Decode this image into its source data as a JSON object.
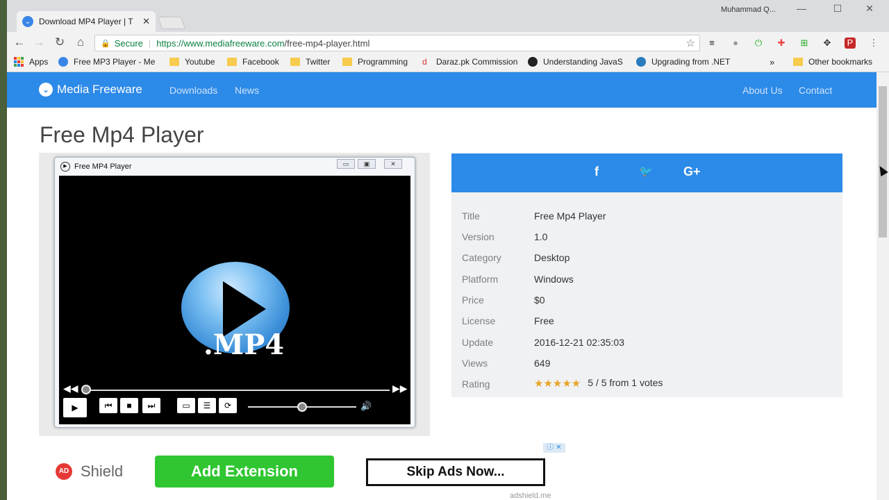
{
  "browser": {
    "tab_title": "Download MP4 Player | T",
    "tab_close": "✕",
    "user_name": "Muhammad Q...",
    "url_secure_label": "Secure",
    "url_host": "https://www.mediafreeware.com",
    "url_path": "/free-mp4-player.html"
  },
  "bookmarks": [
    {
      "label": "Apps"
    },
    {
      "label": "Free MP3 Player - Me"
    },
    {
      "label": "Youtube"
    },
    {
      "label": "Facebook"
    },
    {
      "label": "Twitter"
    },
    {
      "label": "Programming"
    },
    {
      "label": "Daraz.pk Commission"
    },
    {
      "label": "Understanding JavaS"
    },
    {
      "label": "Upgrading from .NET"
    },
    {
      "label": "Other bookmarks"
    }
  ],
  "site": {
    "brand": "Media Freeware",
    "nav_left": [
      "Downloads",
      "News"
    ],
    "nav_right": [
      "About Us",
      "Contact"
    ],
    "page_title": "Free Mp4 Player"
  },
  "player": {
    "window_title": "Free MP4 Player",
    "logo_text": ".MP4",
    "seek_fraction": 0.0,
    "volume_fraction": 0.5
  },
  "social": {
    "facebook": "f",
    "twitter": "🐦",
    "google": "G+"
  },
  "details": {
    "rows": [
      {
        "key": "Title",
        "value": "Free Mp4 Player"
      },
      {
        "key": "Version",
        "value": "1.0"
      },
      {
        "key": "Category",
        "value": "Desktop"
      },
      {
        "key": "Platform",
        "value": "Windows"
      },
      {
        "key": "Price",
        "value": "$0"
      },
      {
        "key": "License",
        "value": "Free"
      },
      {
        "key": "Update",
        "value": "2016-12-21 02:35:03"
      },
      {
        "key": "Views",
        "value": "649"
      }
    ],
    "rating_label": "Rating",
    "rating_stars": 5,
    "rating_text": "5 / 5 from 1 votes"
  },
  "ad": {
    "brand": "Shield",
    "brand_badge": "AD",
    "add_extension": "Add Extension",
    "skip": "Skip Ads Now...",
    "source": "adshield.me"
  },
  "colors": {
    "accent": "#2c8ae8",
    "add_button": "#2fc631",
    "star": "#e8a427"
  }
}
